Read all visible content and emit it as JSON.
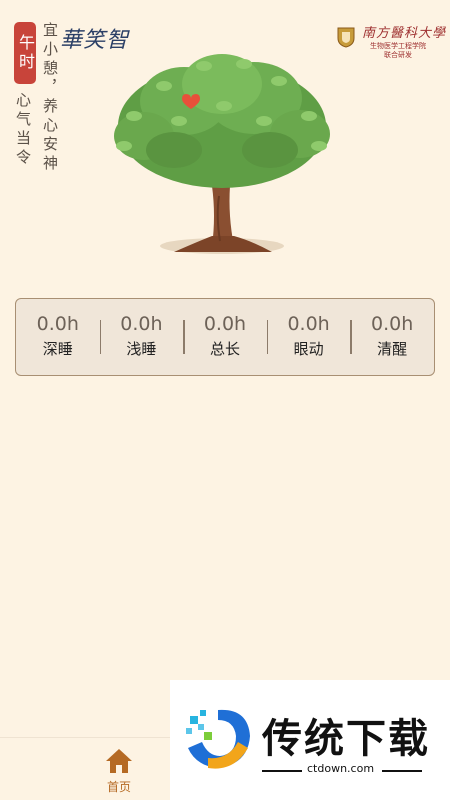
{
  "header": {
    "badge": "午时",
    "slogan_left": "心气当令",
    "slogan_right": "宜小憩，养心安神",
    "brand_signature": "華笑智",
    "university_name": "南方醫科大學",
    "university_sub_line1": "生物医学工程学院",
    "university_sub_line2": "联合研发"
  },
  "stats": [
    {
      "value": "0.0h",
      "label": "深睡"
    },
    {
      "value": "0.0h",
      "label": "浅睡"
    },
    {
      "value": "0.0h",
      "label": "总长"
    },
    {
      "value": "0.0h",
      "label": "眼动"
    },
    {
      "value": "0.0h",
      "label": "清醒"
    }
  ],
  "nav": {
    "home_label": "首页"
  },
  "watermark": {
    "title": "传统下载",
    "url": "ctdown.com"
  },
  "colors": {
    "background": "#fdf3e3",
    "badge": "#c8443a",
    "accent": "#b56a24",
    "card": "#f0e6d9",
    "card_border": "#a88f73"
  }
}
